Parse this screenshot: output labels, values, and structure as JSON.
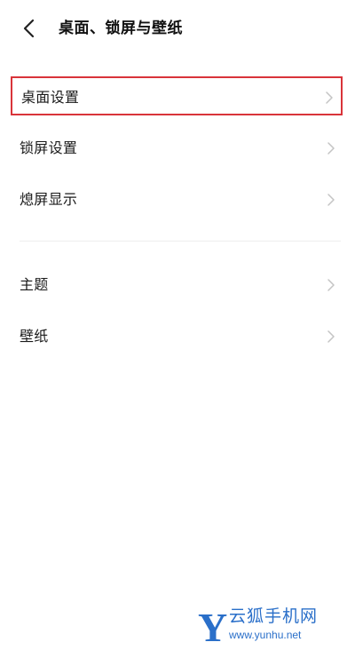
{
  "header": {
    "title": "桌面、锁屏与壁纸",
    "back_icon": "back-arrow-icon"
  },
  "groups": [
    {
      "items": [
        {
          "label": "桌面设置",
          "highlighted": true
        },
        {
          "label": "锁屏设置"
        },
        {
          "label": "熄屏显示"
        }
      ]
    },
    {
      "items": [
        {
          "label": "主题"
        },
        {
          "label": "壁纸"
        }
      ]
    }
  ],
  "watermark": {
    "logo_letter": "Y",
    "name": "云狐手机网",
    "url": "www.yunhu.net"
  },
  "colors": {
    "highlight_border": "#d9343a",
    "watermark_blue": "#2a6fc9",
    "chevron": "#c4c4c4",
    "text": "#1a1a1a"
  }
}
